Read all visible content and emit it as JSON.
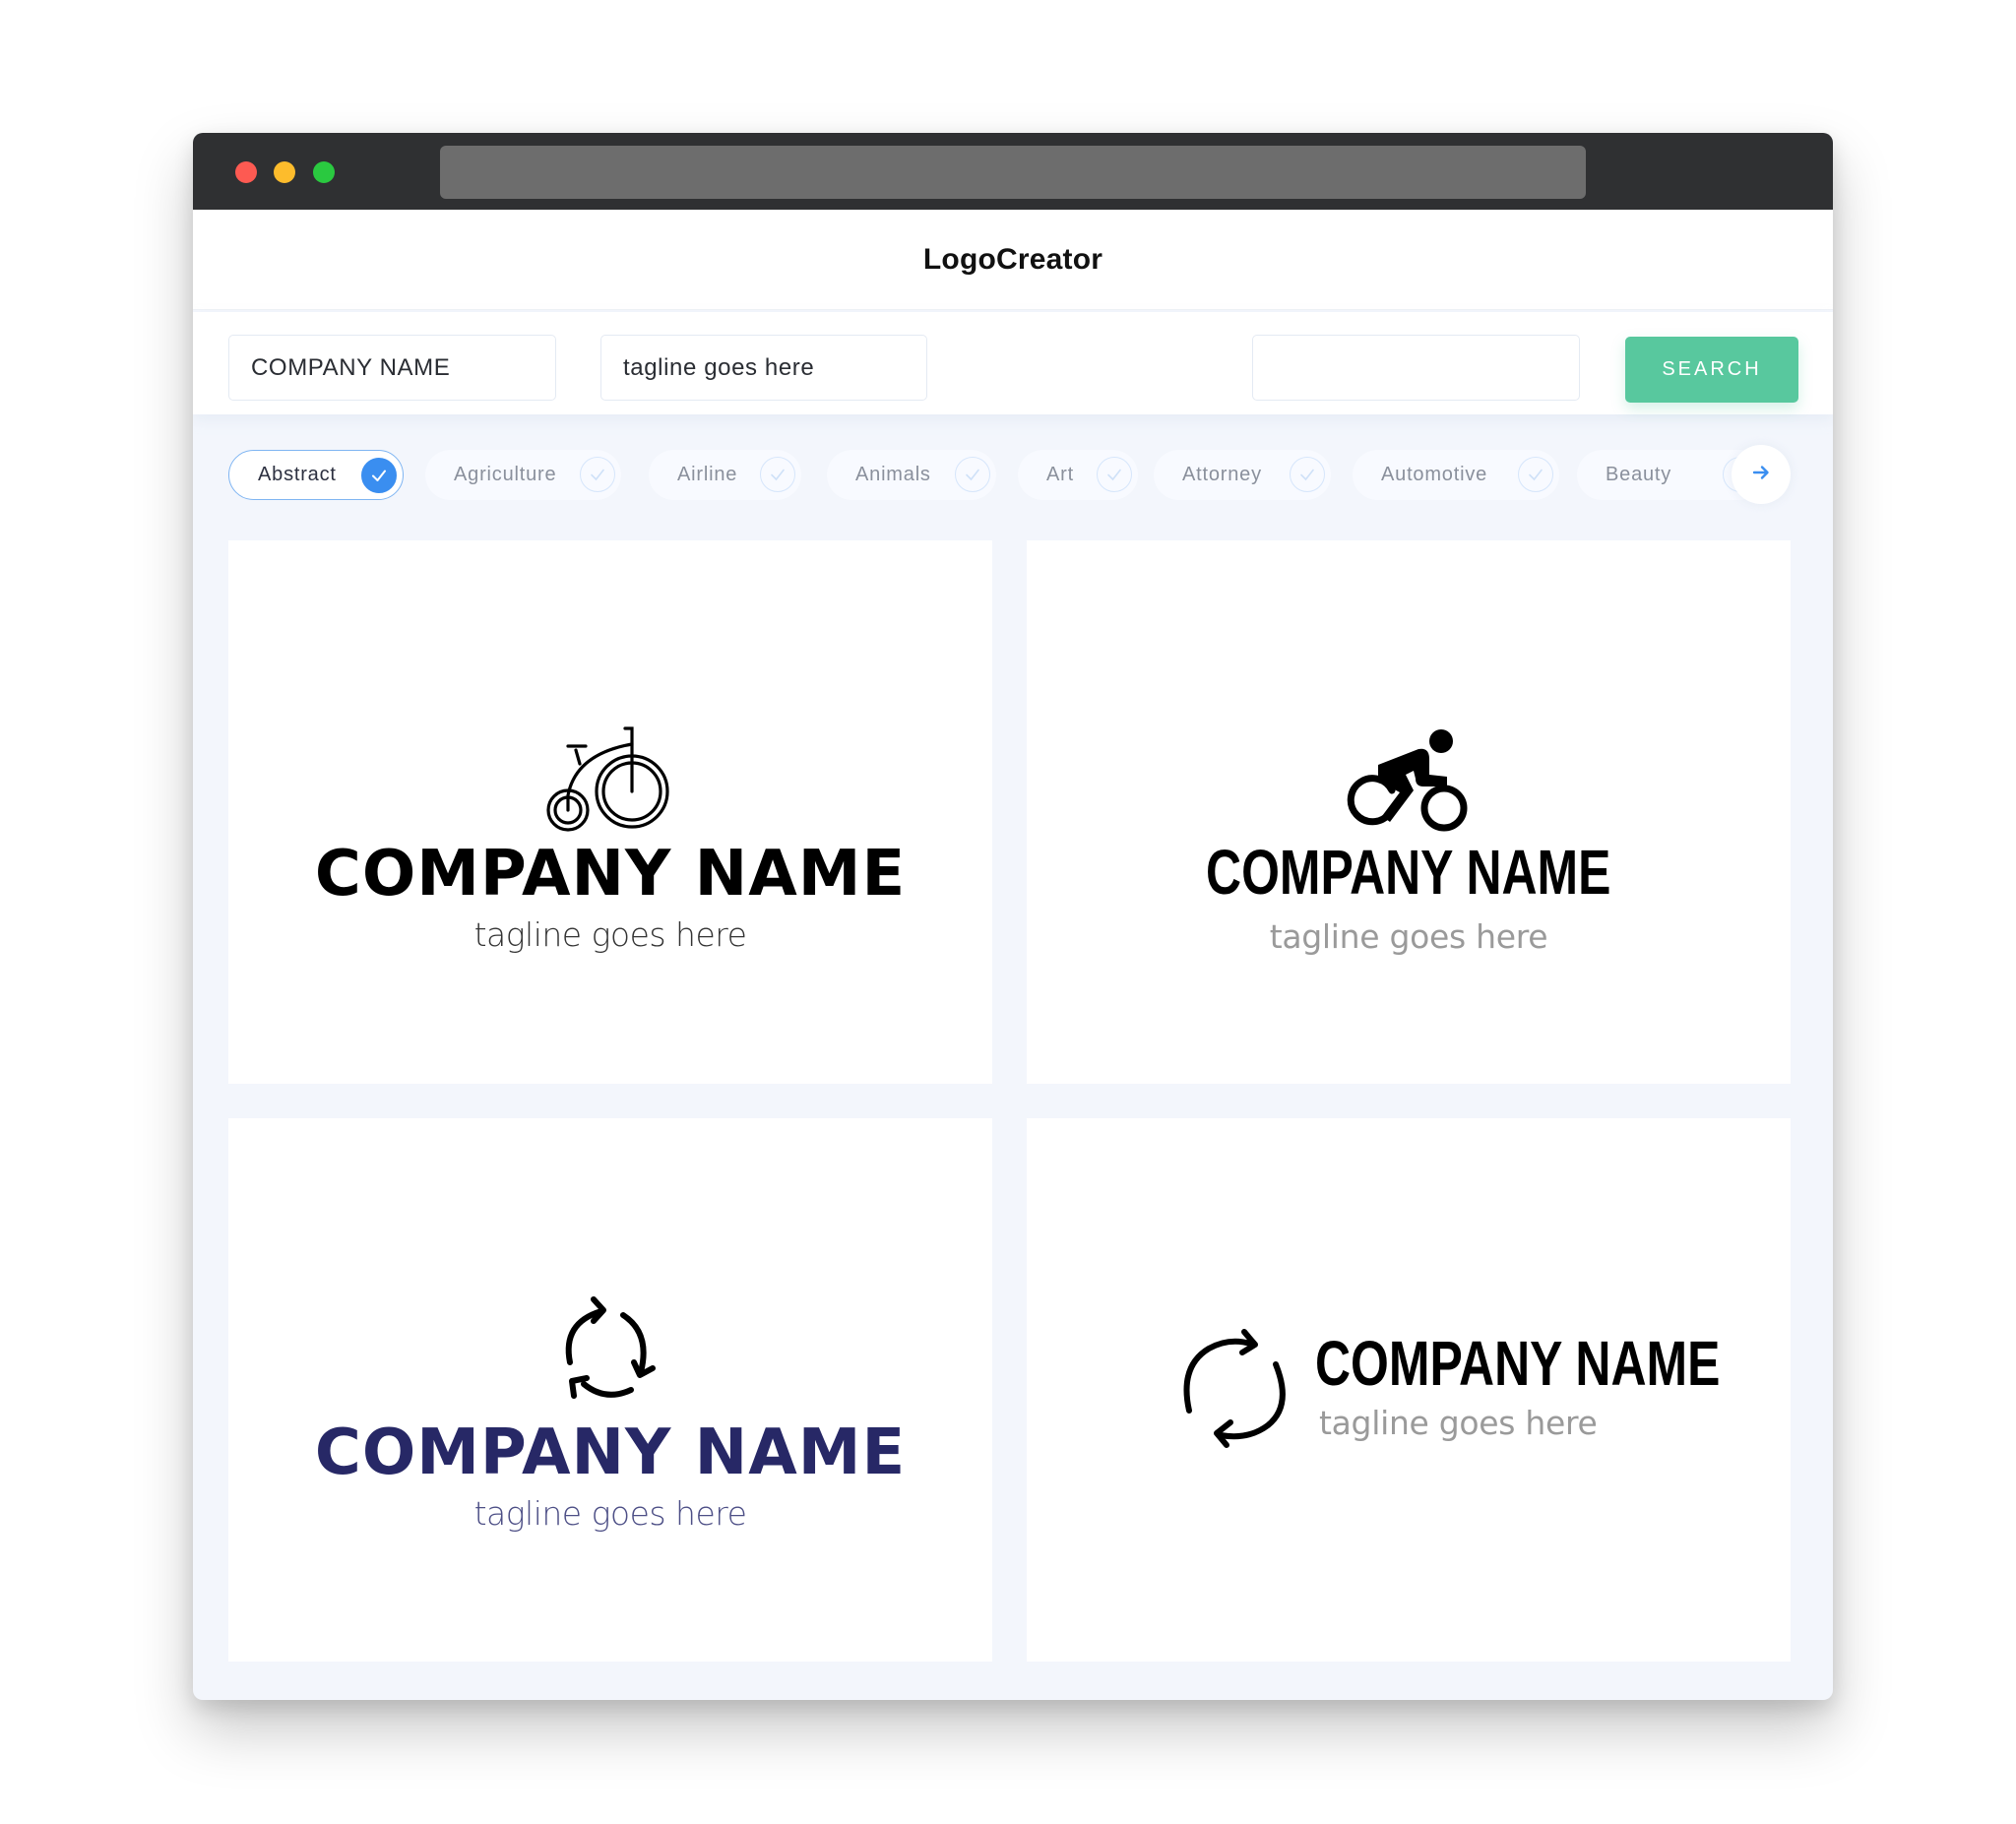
{
  "window": {
    "traffic_lights": [
      "close",
      "minimize",
      "maximize"
    ]
  },
  "header": {
    "brand": "LogoCreator"
  },
  "search": {
    "company_value": "COMPANY NAME",
    "tagline_value": "tagline goes here",
    "keyword_value": "",
    "button_label": "SEARCH"
  },
  "categories": [
    {
      "label": "Abstract",
      "selected": true
    },
    {
      "label": "Agriculture",
      "selected": false
    },
    {
      "label": "Airline",
      "selected": false
    },
    {
      "label": "Animals",
      "selected": false
    },
    {
      "label": "Art",
      "selected": false
    },
    {
      "label": "Attorney",
      "selected": false
    },
    {
      "label": "Automotive",
      "selected": false
    },
    {
      "label": "Beauty",
      "selected": false
    }
  ],
  "category_next_icon": "arrow-right-icon",
  "logos": [
    {
      "icon": "penny-farthing-bicycle-icon",
      "company": "COMPANY NAME",
      "tagline": "tagline goes here",
      "name_color": "#000000",
      "tagline_color": "#333333"
    },
    {
      "icon": "cyclist-icon",
      "company": "COMPANY NAME",
      "tagline": "tagline goes here",
      "name_color": "#000000",
      "tagline_color": "#9a9a9a"
    },
    {
      "icon": "recycle-arrows-icon",
      "company": "COMPANY NAME",
      "tagline": "tagline goes here",
      "name_color": "#272866",
      "tagline_color": "#4d4f86"
    },
    {
      "icon": "refresh-arrows-icon",
      "company": "COMPANY NAME",
      "tagline": "tagline goes here",
      "name_color": "#000000",
      "tagline_color": "#a0a0a0"
    }
  ],
  "colors": {
    "accent": "#58c89e",
    "chip_selected": "#3a8ef0",
    "titlebar": "#2f3032"
  }
}
